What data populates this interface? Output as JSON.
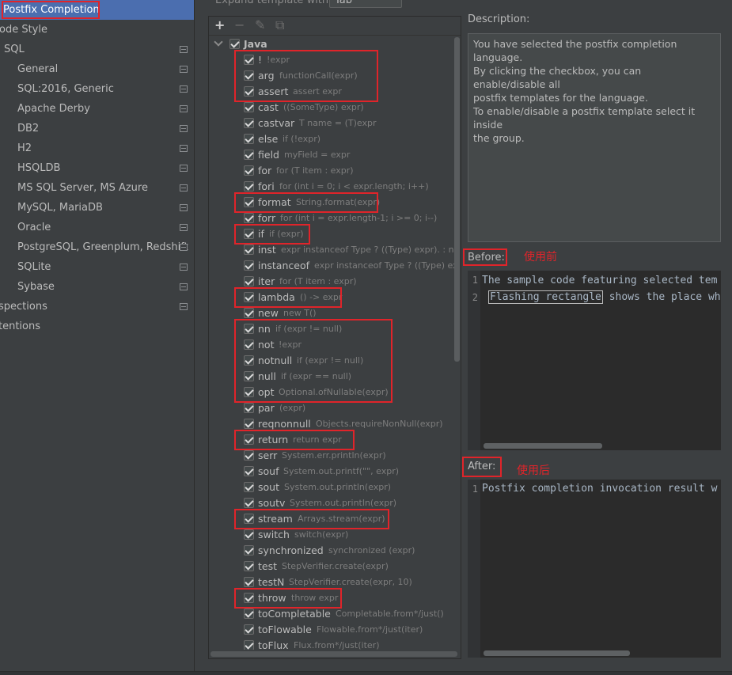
{
  "settings_tree": [
    {
      "label": "Postfix Completion",
      "selected": true
    },
    {
      "label": "ode Style"
    },
    {
      "label": "SQL",
      "project_icon": true
    },
    {
      "label": "General",
      "project_icon": true
    },
    {
      "label": "SQL:2016, Generic",
      "project_icon": true
    },
    {
      "label": "Apache Derby",
      "project_icon": true
    },
    {
      "label": "DB2",
      "project_icon": true
    },
    {
      "label": "H2",
      "project_icon": true
    },
    {
      "label": "HSQLDB",
      "project_icon": true
    },
    {
      "label": "MS SQL Server, MS Azure",
      "project_icon": true
    },
    {
      "label": "MySQL, MariaDB",
      "project_icon": true
    },
    {
      "label": "Oracle",
      "project_icon": true
    },
    {
      "label": "PostgreSQL, Greenplum, Redshift",
      "project_icon": true
    },
    {
      "label": "SQLite",
      "project_icon": true
    },
    {
      "label": "Sybase",
      "project_icon": true
    },
    {
      "label": "spections",
      "project_icon": true
    },
    {
      "label": "tentions"
    }
  ],
  "expand": {
    "label": "Expand template with",
    "value": "Tab"
  },
  "toolbar": {
    "add": "+",
    "remove": "−",
    "edit": "✎",
    "copy": "⧉"
  },
  "templates": {
    "language": "Java",
    "items": [
      {
        "name": "!",
        "desc": "!expr"
      },
      {
        "name": "arg",
        "desc": "functionCall(expr)"
      },
      {
        "name": "assert",
        "desc": "assert expr"
      },
      {
        "name": "cast",
        "desc": "((SomeType) expr)"
      },
      {
        "name": "castvar",
        "desc": "T name = (T)expr"
      },
      {
        "name": "else",
        "desc": "if (!expr)"
      },
      {
        "name": "field",
        "desc": "myField = expr"
      },
      {
        "name": "for",
        "desc": "for (T item : expr)"
      },
      {
        "name": "fori",
        "desc": "for (int i = 0; i < expr.length; i++)"
      },
      {
        "name": "format",
        "desc": "String.format(expr)"
      },
      {
        "name": "forr",
        "desc": "for (int i = expr.length-1; i >= 0; i--)"
      },
      {
        "name": "if",
        "desc": "if (expr)"
      },
      {
        "name": "inst",
        "desc": "expr instanceof Type ? ((Type) expr). : null"
      },
      {
        "name": "instanceof",
        "desc": "expr instanceof Type ? ((Type) expr)."
      },
      {
        "name": "iter",
        "desc": "for (T item : expr)"
      },
      {
        "name": "lambda",
        "desc": "() -> expr"
      },
      {
        "name": "new",
        "desc": "new T()"
      },
      {
        "name": "nn",
        "desc": "if (expr != null)"
      },
      {
        "name": "not",
        "desc": "!expr"
      },
      {
        "name": "notnull",
        "desc": "if (expr != null)"
      },
      {
        "name": "null",
        "desc": "if (expr == null)"
      },
      {
        "name": "opt",
        "desc": "Optional.ofNullable(expr)"
      },
      {
        "name": "par",
        "desc": "(expr)"
      },
      {
        "name": "reqnonnull",
        "desc": "Objects.requireNonNull(expr)"
      },
      {
        "name": "return",
        "desc": "return expr"
      },
      {
        "name": "serr",
        "desc": "System.err.println(expr)"
      },
      {
        "name": "souf",
        "desc": "System.out.printf(\"\", expr)"
      },
      {
        "name": "sout",
        "desc": "System.out.println(expr)"
      },
      {
        "name": "soutv",
        "desc": "System.out.println(expr)"
      },
      {
        "name": "stream",
        "desc": "Arrays.stream(expr)"
      },
      {
        "name": "switch",
        "desc": "switch(expr)"
      },
      {
        "name": "synchronized",
        "desc": "synchronized (expr)"
      },
      {
        "name": "test",
        "desc": "StepVerifier.create(expr)"
      },
      {
        "name": "testN",
        "desc": "StepVerifier.create(expr, 10)"
      },
      {
        "name": "throw",
        "desc": "throw expr"
      },
      {
        "name": "toCompletable",
        "desc": "Completable.from*/just()"
      },
      {
        "name": "toFlowable",
        "desc": "Flowable.from*/just(iter)"
      },
      {
        "name": "toFlux",
        "desc": "Flux.from*/just(iter)"
      }
    ]
  },
  "description": {
    "label": "Description:",
    "lines": [
      "You have selected the postfix completion language.",
      "By clicking the checkbox, you can enable/disable all",
      "postfix templates for the language.",
      "To enable/disable a postfix template select it inside",
      "the group."
    ]
  },
  "before": {
    "label": "Before:",
    "note": "使用前",
    "lines": [
      {
        "num": "1",
        "text": "The sample code featuring selected tem"
      },
      {
        "num": "2",
        "flash": "Flashing rectangle",
        "rest": " shows the place wh"
      }
    ]
  },
  "after": {
    "label": "After:",
    "note": "使用后",
    "lines": [
      {
        "num": "1",
        "text": "Postfix completion invocation result w"
      }
    ]
  },
  "colors": {
    "highlight": "#e0242a",
    "selection": "#4b6eaf",
    "background": "#3c3f41"
  }
}
